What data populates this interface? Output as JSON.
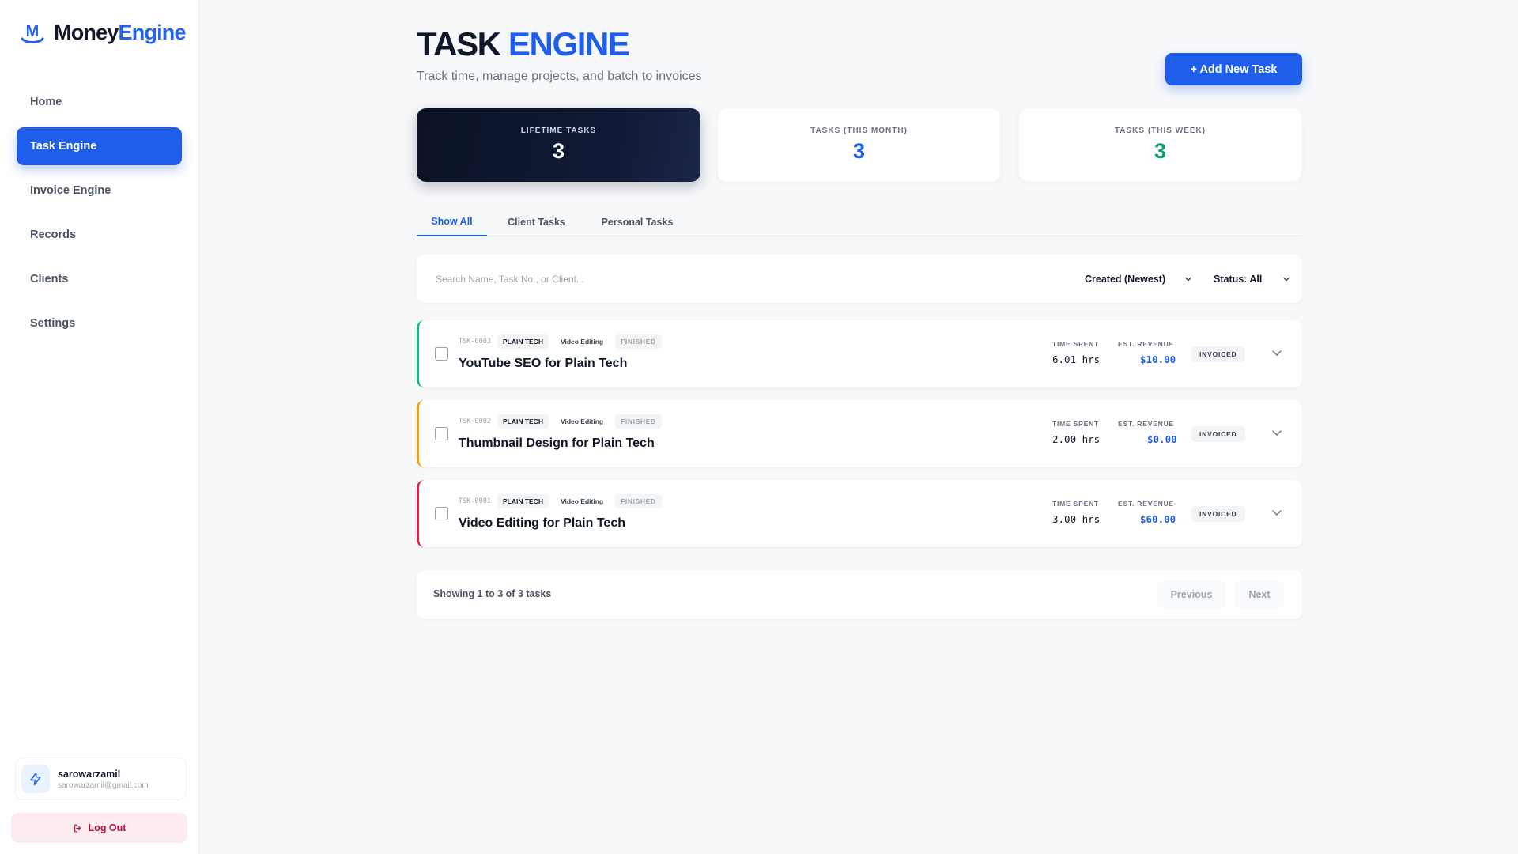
{
  "brand": {
    "name_part1": "Money",
    "name_part2": "Engine",
    "mark_letter": "M"
  },
  "sidebar": {
    "items": [
      {
        "label": "Home",
        "active": false
      },
      {
        "label": "Task Engine",
        "active": true
      },
      {
        "label": "Invoice Engine",
        "active": false
      },
      {
        "label": "Records",
        "active": false
      },
      {
        "label": "Clients",
        "active": false
      },
      {
        "label": "Settings",
        "active": false
      }
    ],
    "user": {
      "name": "sarowarzamil",
      "email": "sarowarzamil@gmail.com"
    },
    "logout_label": "Log Out"
  },
  "header": {
    "title_part1": "TASK",
    "title_part2": "ENGINE",
    "subtitle": "Track time, manage projects, and batch to invoices",
    "add_button": "+ Add New Task"
  },
  "stats": [
    {
      "label": "LIFETIME TASKS",
      "value": "3",
      "color": "#ffffff"
    },
    {
      "label": "TASKS (THIS MONTH)",
      "value": "3",
      "color": "#1e5eea"
    },
    {
      "label": "TASKS (THIS WEEK)",
      "value": "3",
      "color": "#0f9d6e"
    }
  ],
  "tabs": [
    {
      "label": "Show All",
      "active": true
    },
    {
      "label": "Client Tasks",
      "active": false
    },
    {
      "label": "Personal Tasks",
      "active": false
    }
  ],
  "filters": {
    "search_placeholder": "Search Name, Task No., or Client...",
    "sort": "Created (Newest)",
    "status": "Status: All"
  },
  "columns": {
    "time_spent": "TIME SPENT",
    "est_revenue": "EST. REVENUE"
  },
  "tasks": [
    {
      "task_no": "TSK-0003",
      "client": "PLAIN TECH",
      "category": "Video Editing",
      "status": "FINISHED",
      "name": "YouTube SEO for Plain Tech",
      "time_spent": "6.01 hrs",
      "revenue": "$10.00",
      "invoice_status": "INVOICED",
      "accent": "#10b981"
    },
    {
      "task_no": "TSK-0002",
      "client": "PLAIN TECH",
      "category": "Video Editing",
      "status": "FINISHED",
      "name": "Thumbnail Design for Plain Tech",
      "time_spent": "2.00 hrs",
      "revenue": "$0.00",
      "invoice_status": "INVOICED",
      "accent": "#f59e0b"
    },
    {
      "task_no": "TSK-0001",
      "client": "PLAIN TECH",
      "category": "Video Editing",
      "status": "FINISHED",
      "name": "Video Editing for Plain Tech",
      "time_spent": "3.00 hrs",
      "revenue": "$60.00",
      "invoice_status": "INVOICED",
      "accent": "#e11d48"
    }
  ],
  "pagination": {
    "summary": "Showing 1 to 3 of 3 tasks",
    "previous": "Previous",
    "next": "Next"
  },
  "colors": {
    "accent": "#1e5eea",
    "dark_card": "#0b1226"
  }
}
